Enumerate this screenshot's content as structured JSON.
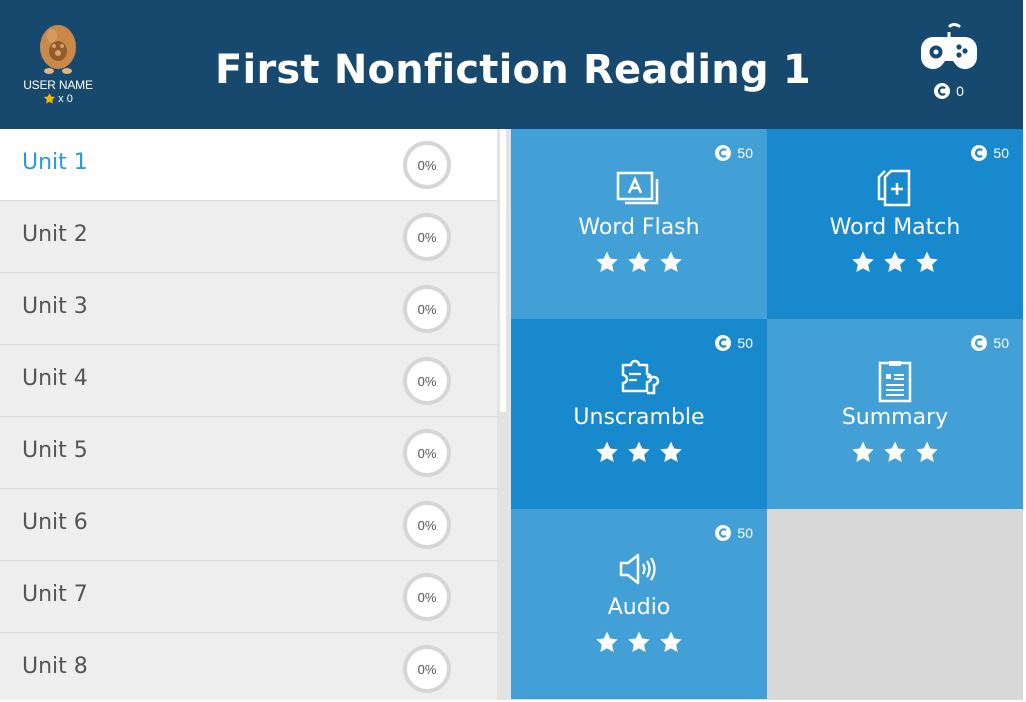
{
  "header": {
    "title": "First Nonfiction Reading 1",
    "user_name": "USER NAME",
    "star_count": "x 0",
    "game_coins": "0"
  },
  "units": [
    {
      "label": "Unit 1",
      "progress": "0%"
    },
    {
      "label": "Unit 2",
      "progress": "0%"
    },
    {
      "label": "Unit 3",
      "progress": "0%"
    },
    {
      "label": "Unit 4",
      "progress": "0%"
    },
    {
      "label": "Unit 5",
      "progress": "0%"
    },
    {
      "label": "Unit 6",
      "progress": "0%"
    },
    {
      "label": "Unit 7",
      "progress": "0%"
    },
    {
      "label": "Unit 8",
      "progress": "0%"
    }
  ],
  "activities": [
    {
      "label": "Word Flash",
      "coins": "50",
      "stars": 3
    },
    {
      "label": "Word Match",
      "coins": "50",
      "stars": 3
    },
    {
      "label": "Unscramble",
      "coins": "50",
      "stars": 3
    },
    {
      "label": "Summary",
      "coins": "50",
      "stars": 3
    },
    {
      "label": "Audio",
      "coins": "50",
      "stars": 3
    }
  ],
  "colors": {
    "header_bg": "#17496e",
    "tile_light": "#42a0d6",
    "tile_dark": "#1789cc",
    "active_unit_text": "#2a9ad6",
    "avatar": "#c8894a",
    "star_badge": "#f5b800"
  },
  "icons": {
    "avatar": "egg-avatar-icon",
    "gamepad": "gamepad-icon",
    "coin": "coin-icon",
    "star": "star-icon",
    "word_flash": "flashcard-icon",
    "word_match": "card-plus-icon",
    "unscramble": "puzzle-icon",
    "summary": "document-icon",
    "audio": "speaker-icon"
  }
}
